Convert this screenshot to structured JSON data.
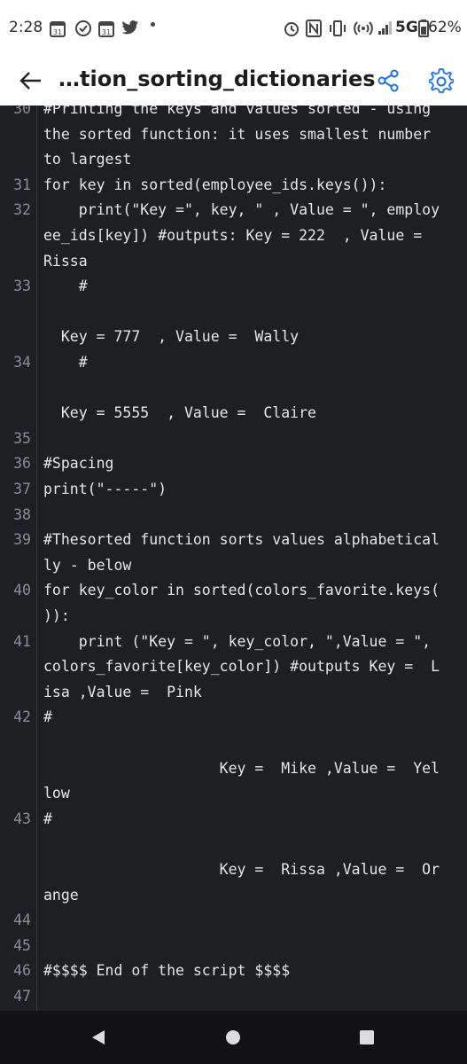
{
  "status_bar": {
    "time": "2:28",
    "network": "5G",
    "battery": "62%"
  },
  "app_bar": {
    "title": "…tion_sorting_dictionaries"
  },
  "code": {
    "lines": [
      {
        "n": "30",
        "text": "#Printing the keys and values sorted - using"
      },
      {
        "n": "",
        "text": "the sorted function: it uses smallest number"
      },
      {
        "n": "",
        "text": "to largest"
      },
      {
        "n": "31",
        "text": "for key in sorted(employee_ids.keys()):"
      },
      {
        "n": "32",
        "text": "    print(\"Key =\", key, \" , Value = \", employ"
      },
      {
        "n": "",
        "text": "ee_ids[key]) #outputs: Key = 222  , Value ="
      },
      {
        "n": "",
        "text": "Rissa"
      },
      {
        "n": "33",
        "text": "    #"
      },
      {
        "n": "",
        "text": ""
      },
      {
        "n": "",
        "text": "  Key = 777  , Value =  Wally"
      },
      {
        "n": "34",
        "text": "    #"
      },
      {
        "n": "",
        "text": ""
      },
      {
        "n": "",
        "text": "  Key = 5555  , Value =  Claire"
      },
      {
        "n": "35",
        "text": ""
      },
      {
        "n": "36",
        "text": "#Spacing"
      },
      {
        "n": "37",
        "text": "print(\"-----\")"
      },
      {
        "n": "38",
        "text": ""
      },
      {
        "n": "39",
        "text": "#Thesorted function sorts values alphabetical"
      },
      {
        "n": "",
        "text": "ly - below"
      },
      {
        "n": "40",
        "text": "for key_color in sorted(colors_favorite.keys("
      },
      {
        "n": "",
        "text": ")):"
      },
      {
        "n": "41",
        "text": "    print (\"Key = \", key_color, \",Value = \","
      },
      {
        "n": "",
        "text": "colors_favorite[key_color]) #outputs Key =  L"
      },
      {
        "n": "",
        "text": "isa ,Value =  Pink"
      },
      {
        "n": "42",
        "text": "#"
      },
      {
        "n": "",
        "text": ""
      },
      {
        "n": "",
        "text": "                    Key =  Mike ,Value =  Yel"
      },
      {
        "n": "",
        "text": "low"
      },
      {
        "n": "43",
        "text": "#"
      },
      {
        "n": "",
        "text": ""
      },
      {
        "n": "",
        "text": "                    Key =  Rissa ,Value =  Or"
      },
      {
        "n": "",
        "text": "ange"
      },
      {
        "n": "44",
        "text": ""
      },
      {
        "n": "45",
        "text": ""
      },
      {
        "n": "46",
        "text": "#$$$$ End of the script $$$$"
      },
      {
        "n": "47",
        "text": ""
      }
    ]
  },
  "icons": {
    "back": "arrow-back-icon",
    "share": "share-icon",
    "settings": "gear-icon"
  },
  "colors": {
    "accent": "#1a73e8",
    "code_bg": "#1e1f22",
    "code_text": "#e6e6e6",
    "line_number": "#8a8d93"
  }
}
